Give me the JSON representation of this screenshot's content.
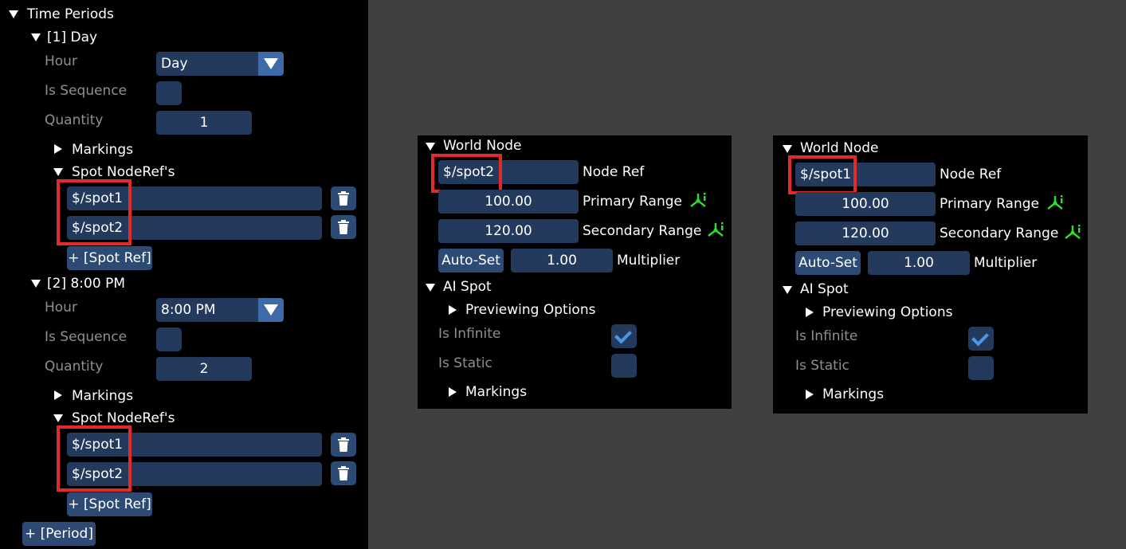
{
  "left": {
    "header": "Time Periods",
    "periods": [
      {
        "title": "[1] Day",
        "hour_label": "Hour",
        "hour_value": "Day",
        "is_sequence_label": "Is Sequence",
        "quantity_label": "Quantity",
        "quantity_value": "1",
        "markings_label": "Markings",
        "spot_refs_label": "Spot NodeRef's",
        "spots": [
          "$/spot1",
          "$/spot2"
        ],
        "add_spot_label": "+ [Spot Ref]"
      },
      {
        "title": "[2] 8:00 PM",
        "hour_label": "Hour",
        "hour_value": "8:00 PM",
        "is_sequence_label": "Is Sequence",
        "quantity_label": "Quantity",
        "quantity_value": "2",
        "markings_label": "Markings",
        "spot_refs_label": "Spot NodeRef's",
        "spots": [
          "$/spot1",
          "$/spot2"
        ],
        "add_spot_label": "+ [Spot Ref]"
      }
    ],
    "add_period_label": "+ [Period]"
  },
  "panels": [
    {
      "world_node_label": "World Node",
      "node_ref_value": "$/spot2",
      "node_ref_label": "Node Ref",
      "primary_range_value": "100.00",
      "primary_range_label": "Primary Range",
      "secondary_range_value": "120.00",
      "secondary_range_label": "Secondary Range",
      "auto_set_label": "Auto-Set",
      "multiplier_value": "1.00",
      "multiplier_label": "Multiplier",
      "ai_spot_label": "AI Spot",
      "previewing_label": "Previewing Options",
      "is_infinite_label": "Is Infinite",
      "is_infinite_checked": true,
      "is_static_label": "Is Static",
      "is_static_checked": false,
      "markings_label": "Markings"
    },
    {
      "world_node_label": "World Node",
      "node_ref_value": "$/spot1",
      "node_ref_label": "Node Ref",
      "primary_range_value": "100.00",
      "primary_range_label": "Primary Range",
      "secondary_range_value": "120.00",
      "secondary_range_label": "Secondary Range",
      "auto_set_label": "Auto-Set",
      "multiplier_value": "1.00",
      "multiplier_label": "Multiplier",
      "ai_spot_label": "AI Spot",
      "previewing_label": "Previewing Options",
      "is_infinite_label": "Is Infinite",
      "is_infinite_checked": true,
      "is_static_label": "Is Static",
      "is_static_checked": false,
      "markings_label": "Markings"
    }
  ],
  "colors": {
    "field_bg": "#233a5c",
    "button_bg": "#2c4a74",
    "highlight_box": "#e32a2a",
    "gizmo_green": "#2ddc2d",
    "check_blue": "#4d97e8"
  },
  "icons": {
    "trash": "trash-icon",
    "gizmo": "axis-gizmo-icon",
    "expanded": "triangle-down-icon",
    "collapsed": "triangle-right-icon"
  }
}
